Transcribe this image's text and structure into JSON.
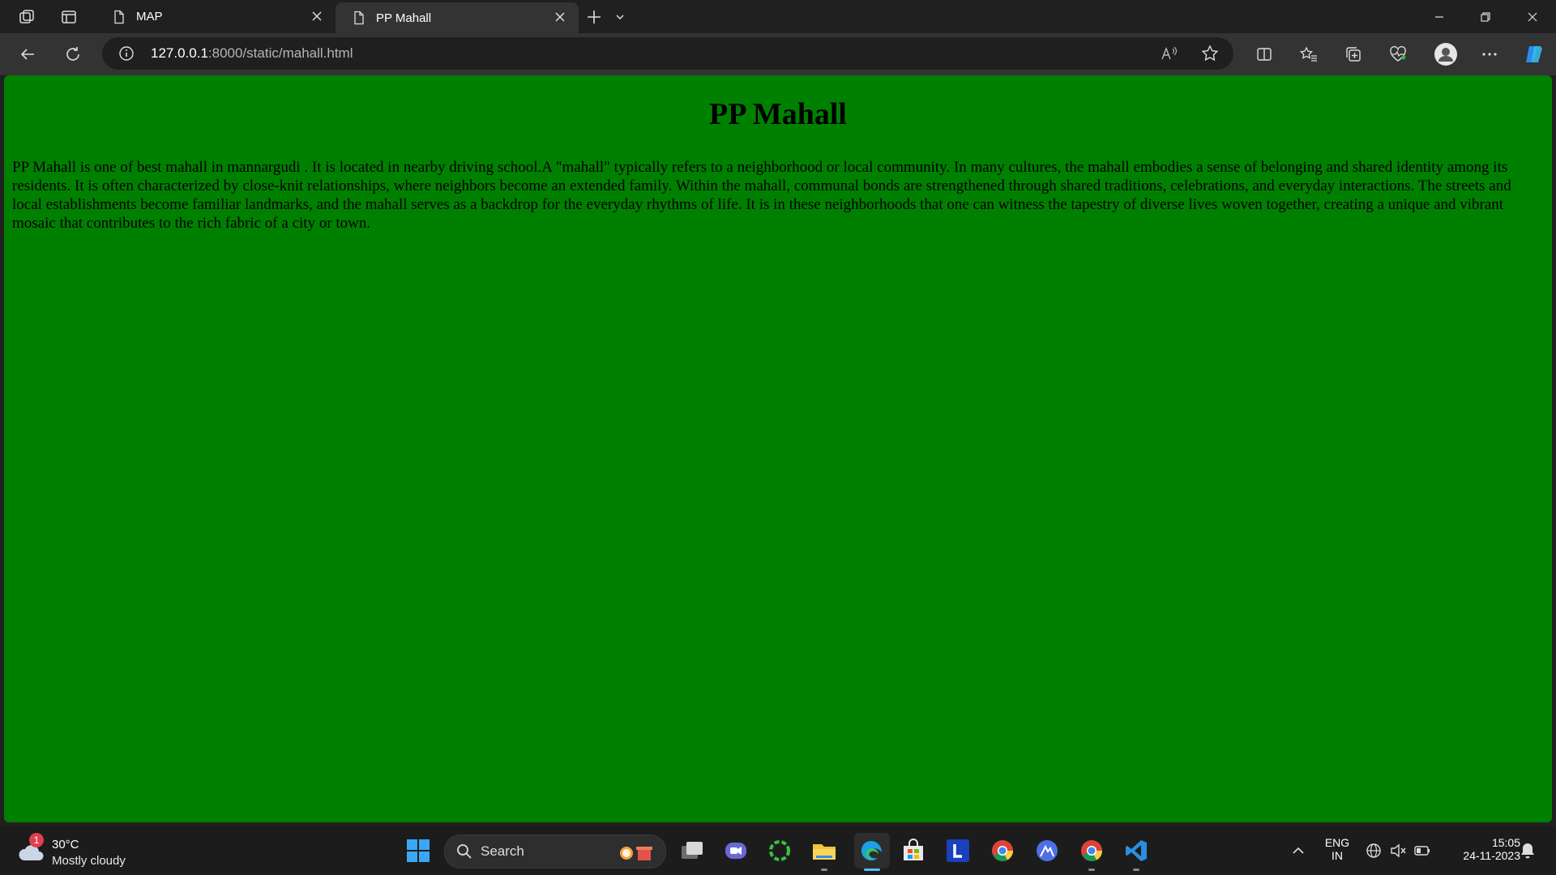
{
  "browser": {
    "tabs": [
      {
        "label": "MAP",
        "active": false
      },
      {
        "label": "PP Mahall",
        "active": true
      }
    ],
    "address": {
      "host": "127.0.0.1",
      "path": ":8000/static/mahall.html"
    }
  },
  "page": {
    "title": "PP Mahall",
    "paragraph": "PP Mahall is one of best mahall in mannargudi . It is located in nearby driving school.A \"mahall\" typically refers to a neighborhood or local community. In many cultures, the mahall embodies a sense of belonging and shared identity among its residents. It is often characterized by close-knit relationships, where neighbors become an extended family. Within the mahall, communal bonds are strengthened through shared traditions, celebrations, and everyday interactions. The streets and local establishments become familiar landmarks, and the mahall serves as a backdrop for the everyday rhythms of life. It is in these neighborhoods that one can witness the tapestry of diverse lives woven together, creating a unique and vibrant mosaic that contributes to the rich fabric of a city or town.",
    "background_color": "#008000"
  },
  "taskbar": {
    "weather": {
      "badge": "1",
      "temperature": "30°C",
      "condition": "Mostly cloudy"
    },
    "search_label": "Search",
    "language": {
      "line1": "ENG",
      "line2": "IN"
    },
    "clock": {
      "time": "15:05",
      "date": "24-11-2023"
    }
  }
}
